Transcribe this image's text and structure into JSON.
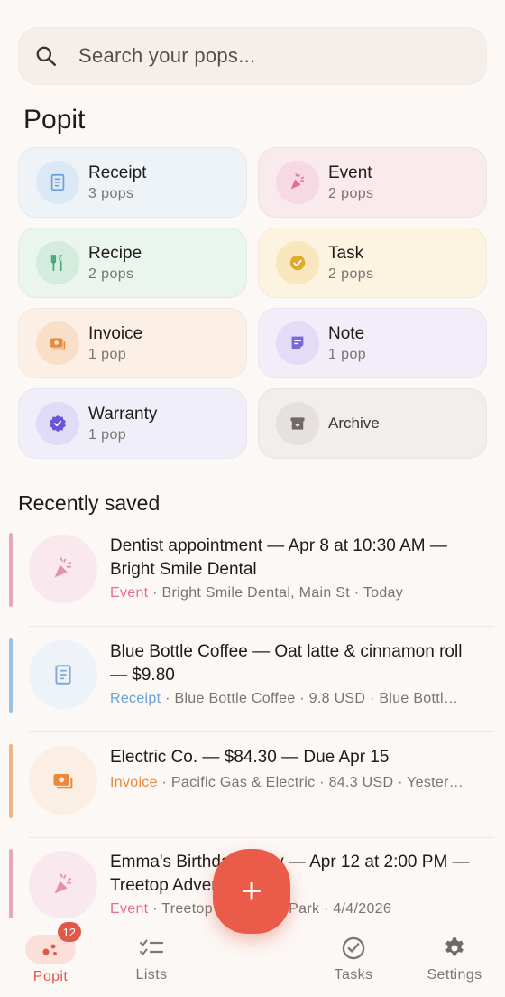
{
  "search": {
    "placeholder": "Search your pops..."
  },
  "section_title": "Popit",
  "categories": [
    {
      "name": "Receipt",
      "count": "3 pops",
      "icon": "receipt-icon",
      "color": "#6b9fd6"
    },
    {
      "name": "Event",
      "count": "2 pops",
      "icon": "party-popper-icon",
      "color": "#de6f9a"
    },
    {
      "name": "Recipe",
      "count": "2 pops",
      "icon": "utensils-icon",
      "color": "#3aa873"
    },
    {
      "name": "Task",
      "count": "2 pops",
      "icon": "check-circle-icon",
      "color": "#e2a92c"
    },
    {
      "name": "Invoice",
      "count": "1 pop",
      "icon": "money-icon",
      "color": "#e88a3e"
    },
    {
      "name": "Note",
      "count": "1 pop",
      "icon": "note-icon",
      "color": "#7b68d9"
    },
    {
      "name": "Warranty",
      "count": "1 pop",
      "icon": "verified-badge-icon",
      "color": "#6a55d8"
    },
    {
      "name": "Archive",
      "icon": "archive-icon",
      "color": "#6f6a66"
    }
  ],
  "recent_title": "Recently saved",
  "recent_items": [
    {
      "title": "Dentist appointment — Apr 8 at 10:30 AM — Bright Smile Dental",
      "type": "Event",
      "meta": " · Bright Smile Dental, Main St · Today",
      "icon": "party-popper-icon",
      "color": "#de6f9a"
    },
    {
      "title": "Blue Bottle Coffee — Oat latte & cinnamon roll — $9.80",
      "type": "Receipt",
      "meta": " · Blue Bottle Coffee · 9.8 USD · Blue Bottl…",
      "icon": "receipt-icon",
      "color": "#6b9fd6"
    },
    {
      "title": "Electric Co. — $84.30 — Due Apr 15",
      "type": "Invoice",
      "meta": " · Pacific Gas & Electric · 84.3 USD · Yester…",
      "icon": "money-icon",
      "color": "#e88a3e"
    },
    {
      "title": "Emma's Birthday Party — Apr 12 at 2:00 PM — Treetop Adventure Park",
      "type": "Event",
      "meta": " · Treetop Adventure Park · 4/4/2026",
      "icon": "party-popper-icon",
      "color": "#de6f9a"
    }
  ],
  "fab": {
    "label": "+"
  },
  "nav": {
    "popit": "Popit",
    "popit_badge": "12",
    "lists": "Lists",
    "tasks": "Tasks",
    "settings": "Settings"
  },
  "colors": {
    "accent": "#e0584a",
    "background": "#fcf8f5"
  }
}
